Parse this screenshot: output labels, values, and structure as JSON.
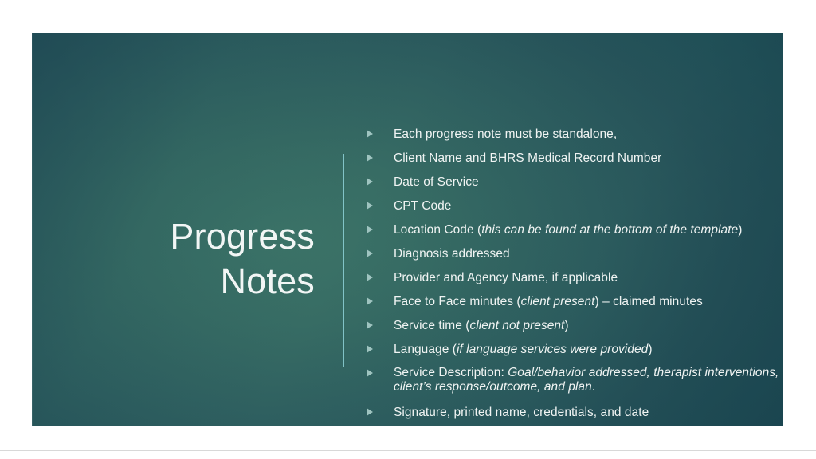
{
  "slide": {
    "title_lines": [
      "Progress",
      "Notes"
    ],
    "colors": {
      "gradient_center": "#3c7468",
      "gradient_edge": "#163c49",
      "text": "#f0f4f3",
      "title_text": "#f2f6f5",
      "divider": "#8fd2d8",
      "bullet_marker": "#9fc4c0",
      "page_background": "#ffffff"
    },
    "divider_icon": "vertical-rule",
    "bullet_icon": "triangle-right-icon",
    "bullets": [
      {
        "id": "standalone",
        "segments": [
          {
            "text": "Each progress note must be standalone,",
            "italic": false
          }
        ]
      },
      {
        "id": "client-name-mrn",
        "segments": [
          {
            "text": "Client Name and BHRS Medical Record Number",
            "italic": false
          }
        ]
      },
      {
        "id": "date-of-service",
        "segments": [
          {
            "text": "Date of Service",
            "italic": false
          }
        ]
      },
      {
        "id": "cpt-code",
        "segments": [
          {
            "text": "CPT Code",
            "italic": false
          }
        ]
      },
      {
        "id": "location-code",
        "segments": [
          {
            "text": "Location Code (",
            "italic": false
          },
          {
            "text": "this can be found at the bottom of the template",
            "italic": true
          },
          {
            "text": ")",
            "italic": false
          }
        ]
      },
      {
        "id": "diagnosis-addressed",
        "segments": [
          {
            "text": "Diagnosis addressed",
            "italic": false
          }
        ]
      },
      {
        "id": "provider-agency-name",
        "segments": [
          {
            "text": "Provider and Agency Name, if applicable",
            "italic": false
          }
        ]
      },
      {
        "id": "face-to-face-minutes",
        "segments": [
          {
            "text": "Face to Face minutes (",
            "italic": false
          },
          {
            "text": "client present",
            "italic": true
          },
          {
            "text": ") – claimed minutes",
            "italic": false
          }
        ]
      },
      {
        "id": "service-time",
        "segments": [
          {
            "text": "Service time (",
            "italic": false
          },
          {
            "text": "client not present",
            "italic": true
          },
          {
            "text": ")",
            "italic": false
          }
        ]
      },
      {
        "id": "language",
        "segments": [
          {
            "text": "Language (",
            "italic": false
          },
          {
            "text": "if language services were provided",
            "italic": true
          },
          {
            "text": ")",
            "italic": false
          }
        ]
      },
      {
        "id": "service-description",
        "multiline": true,
        "segments": [
          {
            "text": "Service Description: ",
            "italic": false
          },
          {
            "text": "Goal/behavior addressed, therapist interventions, client’s response/outcome, and plan",
            "italic": true
          },
          {
            "text": ".",
            "italic": false
          }
        ]
      },
      {
        "id": "signature-line",
        "segments": [
          {
            "text": "Signature, printed name, credentials, and date",
            "italic": false
          }
        ]
      }
    ]
  }
}
